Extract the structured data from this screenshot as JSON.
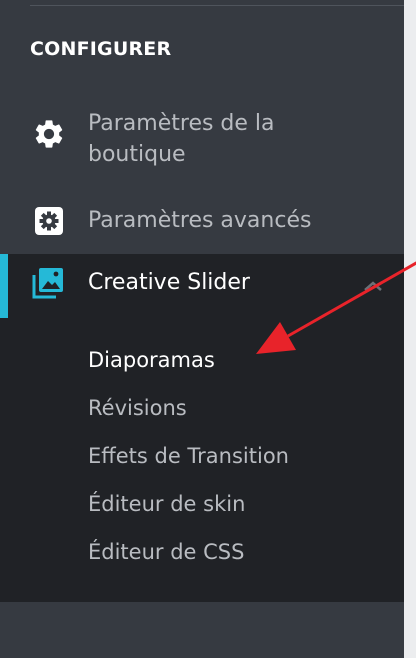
{
  "section": {
    "title": "CONFIGURER"
  },
  "menu": {
    "shop_params": {
      "label": "Paramètres de la boutique",
      "icon": "gear-icon"
    },
    "advanced_params": {
      "label": "Paramètres avancés",
      "icon": "settings-box-icon"
    },
    "creative_slider": {
      "label": "Creative Slider",
      "icon": "image-gallery-icon",
      "expanded": true,
      "submenu": [
        {
          "label": "Diaporamas",
          "active": true
        },
        {
          "label": "Révisions"
        },
        {
          "label": "Effets de Transition"
        },
        {
          "label": "Éditeur de skin"
        },
        {
          "label": "Éditeur de CSS"
        }
      ]
    }
  },
  "colors": {
    "sidebar_bg": "#363a41",
    "active_bg": "#202226",
    "accent": "#25b9d7",
    "annotation": "#e8232a"
  }
}
